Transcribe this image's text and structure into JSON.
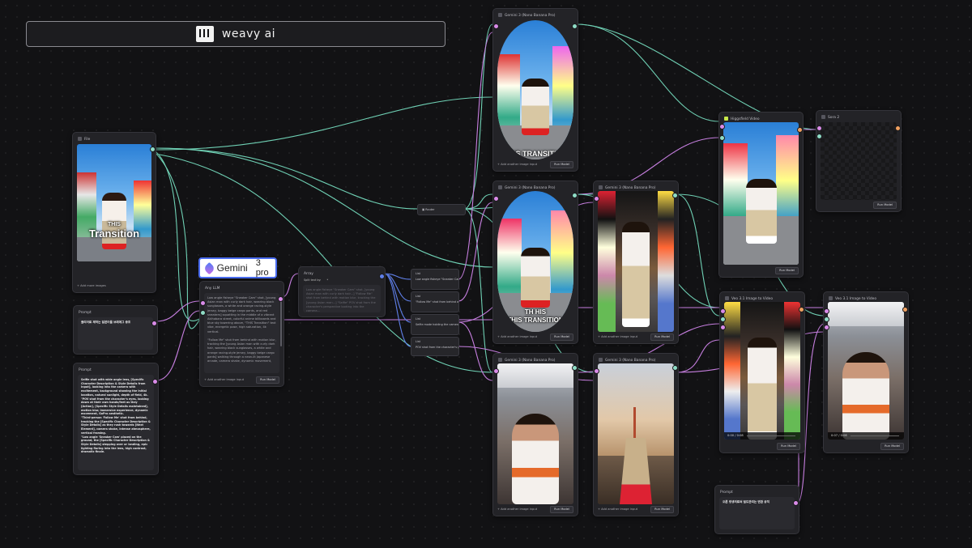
{
  "brand": {
    "name": "weavy ai"
  },
  "colors": {
    "wire_teal": "#6fd0b4",
    "wire_purple": "#c77fe0",
    "wire_blue": "#5f7fe8",
    "canvas": "#121214"
  },
  "nodes": {
    "file": {
      "title": "File",
      "footer": "+ Add more images",
      "overlay_small": "THIS",
      "overlay_big": "Transition"
    },
    "prompt1": {
      "title": "Prompt",
      "text": "클리어로 제작는 일본어를 브레에그 중조"
    },
    "prompt2": {
      "title": "Prompt",
      "text": "Selfie shot with wide angle lens, [Specific Character Description & Style Details from Input], looking into the camera with excitement, background showing the initial location, natural sunlight, depth of field, 4k.\n\"POV shot from the character's eyes, looking down at their own hands/feet as they [Action], [Specific Style Details maintained], motion blur, immersive experience, dynamic movement, GoPro aesthetic.\n\"Third-person 'Follow Me' shot from behind, tracking the [Specific Character Description & Style Details] as they rush towards [Next Element], camera shake, intense atmosphere, vertical framing.\n\"Low angle 'Sneaker Cam' placed on the ground, the [Specific Character Description & Style Details] stepping over or landing, epic lighting flaring into the lens, high contrast, dramatic finale."
    },
    "anyllm": {
      "title": "Any LLM",
      "brand_word": "Gemini",
      "brand_version": "3 pro",
      "text": "Low angle fisheye \"Sneaker Cam\" shot, [young Asian man with curly dark hair, wearing black sunglasses, a white and orange racing-style jersey, baggy beige cargo pants, and red sneakers] squatting in the middle of a vibrant Akihabara street, colorful anime billboards and blue sky towering above, \"THIS Transition\" text vibe, energetic pose, high saturation, 4k vertical.\n\n\"Follow Me\" shot from behind with motion blur, tracking the [young Asian man with curly dark hair, wearing black sunglasses, a white and orange racing-style jersey, baggy beige cargo pants] walking through a neon-lit Japanese arcade, camera shake, dynamic movement,",
      "footer": "+ Add another image input",
      "run": "Run Model"
    },
    "array": {
      "title": "Array",
      "split_label": "Split text by:",
      "split_value": "*",
      "text": "Low angle fisheye \"Sneaker Cam\" shot, [young Asian man with curly dark hair...] \"Follow Me\" shot from behind with motion blur, tracking the [young Asian man...] \"Selfie\" POV shot from the character's perspective looking into the camera..."
    },
    "router": {
      "title": "Router"
    },
    "lists": [
      {
        "title": "List",
        "text": "Low angle fisheye \"Sneaker Cam\"..."
      },
      {
        "title": "List",
        "text": "\"Follow Me\" shot from behind wit..."
      },
      {
        "title": "List",
        "text": "Selfie mode holding the camera..."
      },
      {
        "title": "List",
        "text": "POV shot from the character's p..."
      }
    ],
    "gem1": {
      "title": "Gemini 3 (Nano Banana Pro)",
      "overlay": "THIS TRANSITION",
      "footer": "+ Add another image input",
      "run": "Run Model"
    },
    "gem2": {
      "title": "Gemini 3 (Nano Banana Pro)",
      "overlay_top": "TH HIS",
      "overlay": "THIS TRANSITION",
      "footer": "+ Add another image input",
      "run": "Run Model"
    },
    "gem3": {
      "title": "Gemini 3 (Nano Banana Pro)",
      "footer": "+ Add another image input",
      "run": "Run Model"
    },
    "gem4": {
      "title": "Gemini 3 (Nano Banana Pro)",
      "footer": "+ Add another image input",
      "run": "Run Model"
    },
    "gem5": {
      "title": "Gemini 3 (Nano Banana Pro)",
      "footer": "+ Add another image input",
      "run": "Run Model"
    },
    "higgs": {
      "title": "Higgsfield Video",
      "run": "Run Model"
    },
    "sora": {
      "title": "Sora 2",
      "run": "Run Model"
    },
    "veo1": {
      "title": "Veo 3.1 Image to Video",
      "time": "0:00 / 0:08",
      "run": "Run Model"
    },
    "veo2": {
      "title": "Veo 3.1 Image to Video",
      "time": "0:07 / 0:08",
      "run": "Run Model"
    },
    "prompt3": {
      "title": "Prompt",
      "text": "오른 방생의로써 밀도관리는 변환 공직"
    }
  }
}
